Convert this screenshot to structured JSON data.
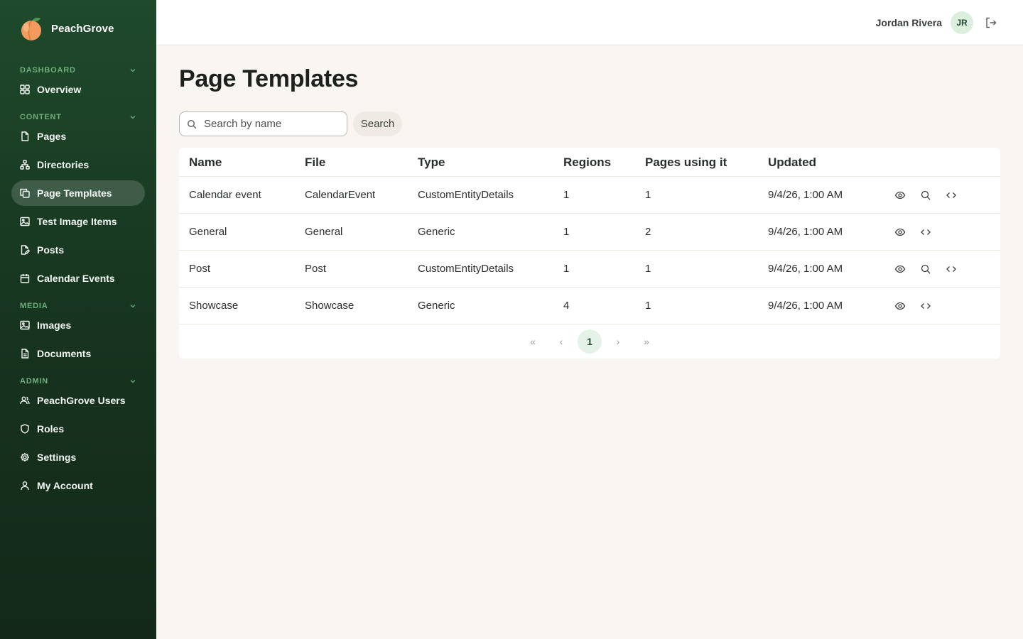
{
  "app": {
    "name": "PeachGrove"
  },
  "sidebar": {
    "sections": [
      {
        "label": "DASHBOARD",
        "items": [
          {
            "label": "Overview",
            "icon": "grid-icon"
          }
        ]
      },
      {
        "label": "CONTENT",
        "items": [
          {
            "label": "Pages",
            "icon": "file-icon"
          },
          {
            "label": "Directories",
            "icon": "sitemap-icon"
          },
          {
            "label": "Page Templates",
            "icon": "copy-icon",
            "active": true
          },
          {
            "label": "Test Image Items",
            "icon": "image-icon"
          },
          {
            "label": "Posts",
            "icon": "file-edit-icon"
          },
          {
            "label": "Calendar Events",
            "icon": "calendar-icon"
          }
        ]
      },
      {
        "label": "MEDIA",
        "items": [
          {
            "label": "Images",
            "icon": "image-icon"
          },
          {
            "label": "Documents",
            "icon": "document-icon"
          }
        ]
      },
      {
        "label": "ADMIN",
        "items": [
          {
            "label": "PeachGrove Users",
            "icon": "users-icon"
          },
          {
            "label": "Roles",
            "icon": "shield-icon"
          },
          {
            "label": "Settings",
            "icon": "gear-icon"
          },
          {
            "label": "My Account",
            "icon": "user-icon"
          }
        ]
      }
    ]
  },
  "topbar": {
    "user_name": "Jordan Rivera",
    "avatar_initials": "JR"
  },
  "main": {
    "title": "Page Templates",
    "search": {
      "placeholder": "Search by name",
      "value": "",
      "button_label": "Search"
    },
    "table": {
      "columns": [
        "Name",
        "File",
        "Type",
        "Regions",
        "Pages using it",
        "Updated"
      ],
      "rows": [
        {
          "name": "Calendar event",
          "file": "CalendarEvent",
          "type": "CustomEntityDetails",
          "regions": "1",
          "pages": "1",
          "updated": "9/4/26, 1:00 AM",
          "actions": [
            "view",
            "search",
            "code"
          ]
        },
        {
          "name": "General",
          "file": "General",
          "type": "Generic",
          "regions": "1",
          "pages": "2",
          "updated": "9/4/26, 1:00 AM",
          "actions": [
            "view",
            "code"
          ]
        },
        {
          "name": "Post",
          "file": "Post",
          "type": "CustomEntityDetails",
          "regions": "1",
          "pages": "1",
          "updated": "9/4/26, 1:00 AM",
          "actions": [
            "view",
            "search",
            "code"
          ]
        },
        {
          "name": "Showcase",
          "file": "Showcase",
          "type": "Generic",
          "regions": "4",
          "pages": "1",
          "updated": "9/4/26, 1:00 AM",
          "actions": [
            "view",
            "code"
          ]
        }
      ]
    },
    "pagination": {
      "first": "«",
      "prev": "‹",
      "current": "1",
      "next": "›",
      "last": "»"
    }
  },
  "colors": {
    "sidebar_top": "#1f4a2c",
    "sidebar_bottom": "#132819",
    "accent": "#6fae7c",
    "background": "#f9f6f2",
    "avatar_bg": "#dcefdf"
  }
}
